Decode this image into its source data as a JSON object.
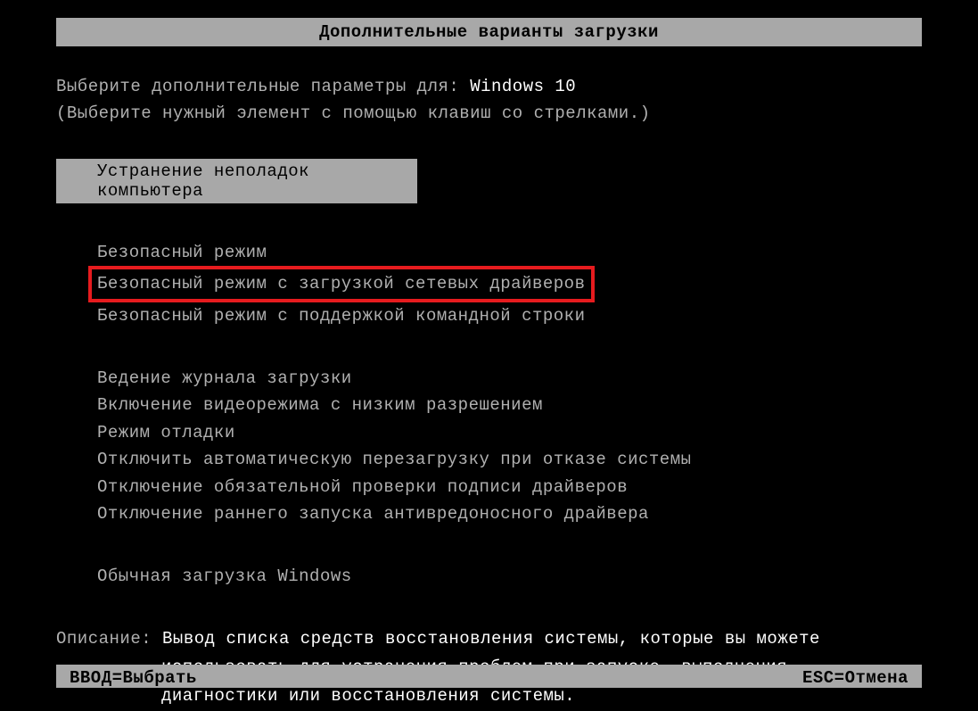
{
  "title": "Дополнительные варианты загрузки",
  "instruction": {
    "line1_prefix": "Выберите дополнительные параметры для: ",
    "os_name": "Windows 10",
    "line2": "(Выберите нужный элемент с помощью клавиш со стрелками.)"
  },
  "selected_option": "Устранение неполадок компьютера",
  "menu": {
    "group1": [
      "Безопасный режим",
      "Безопасный режим с загрузкой сетевых драйверов",
      "Безопасный режим с поддержкой командной строки"
    ],
    "group2": [
      "Ведение журнала загрузки",
      "Включение видеорежима с низким разрешением",
      "Режим отладки",
      "Отключить автоматическую перезагрузку при отказе системы",
      "Отключение обязательной проверки подписи драйверов",
      "Отключение раннего запуска антивредоносного драйвера"
    ],
    "group3": [
      "Обычная загрузка Windows"
    ]
  },
  "description": {
    "label": "Описание: ",
    "line1": "Вывод списка средств восстановления системы, которые вы можете",
    "line2": "использовать для устранения проблем при запуске, выполнения",
    "line3": "диагностики или восстановления системы."
  },
  "footer": {
    "enter": "ВВОД=Выбрать",
    "esc": "ESC=Отмена"
  }
}
